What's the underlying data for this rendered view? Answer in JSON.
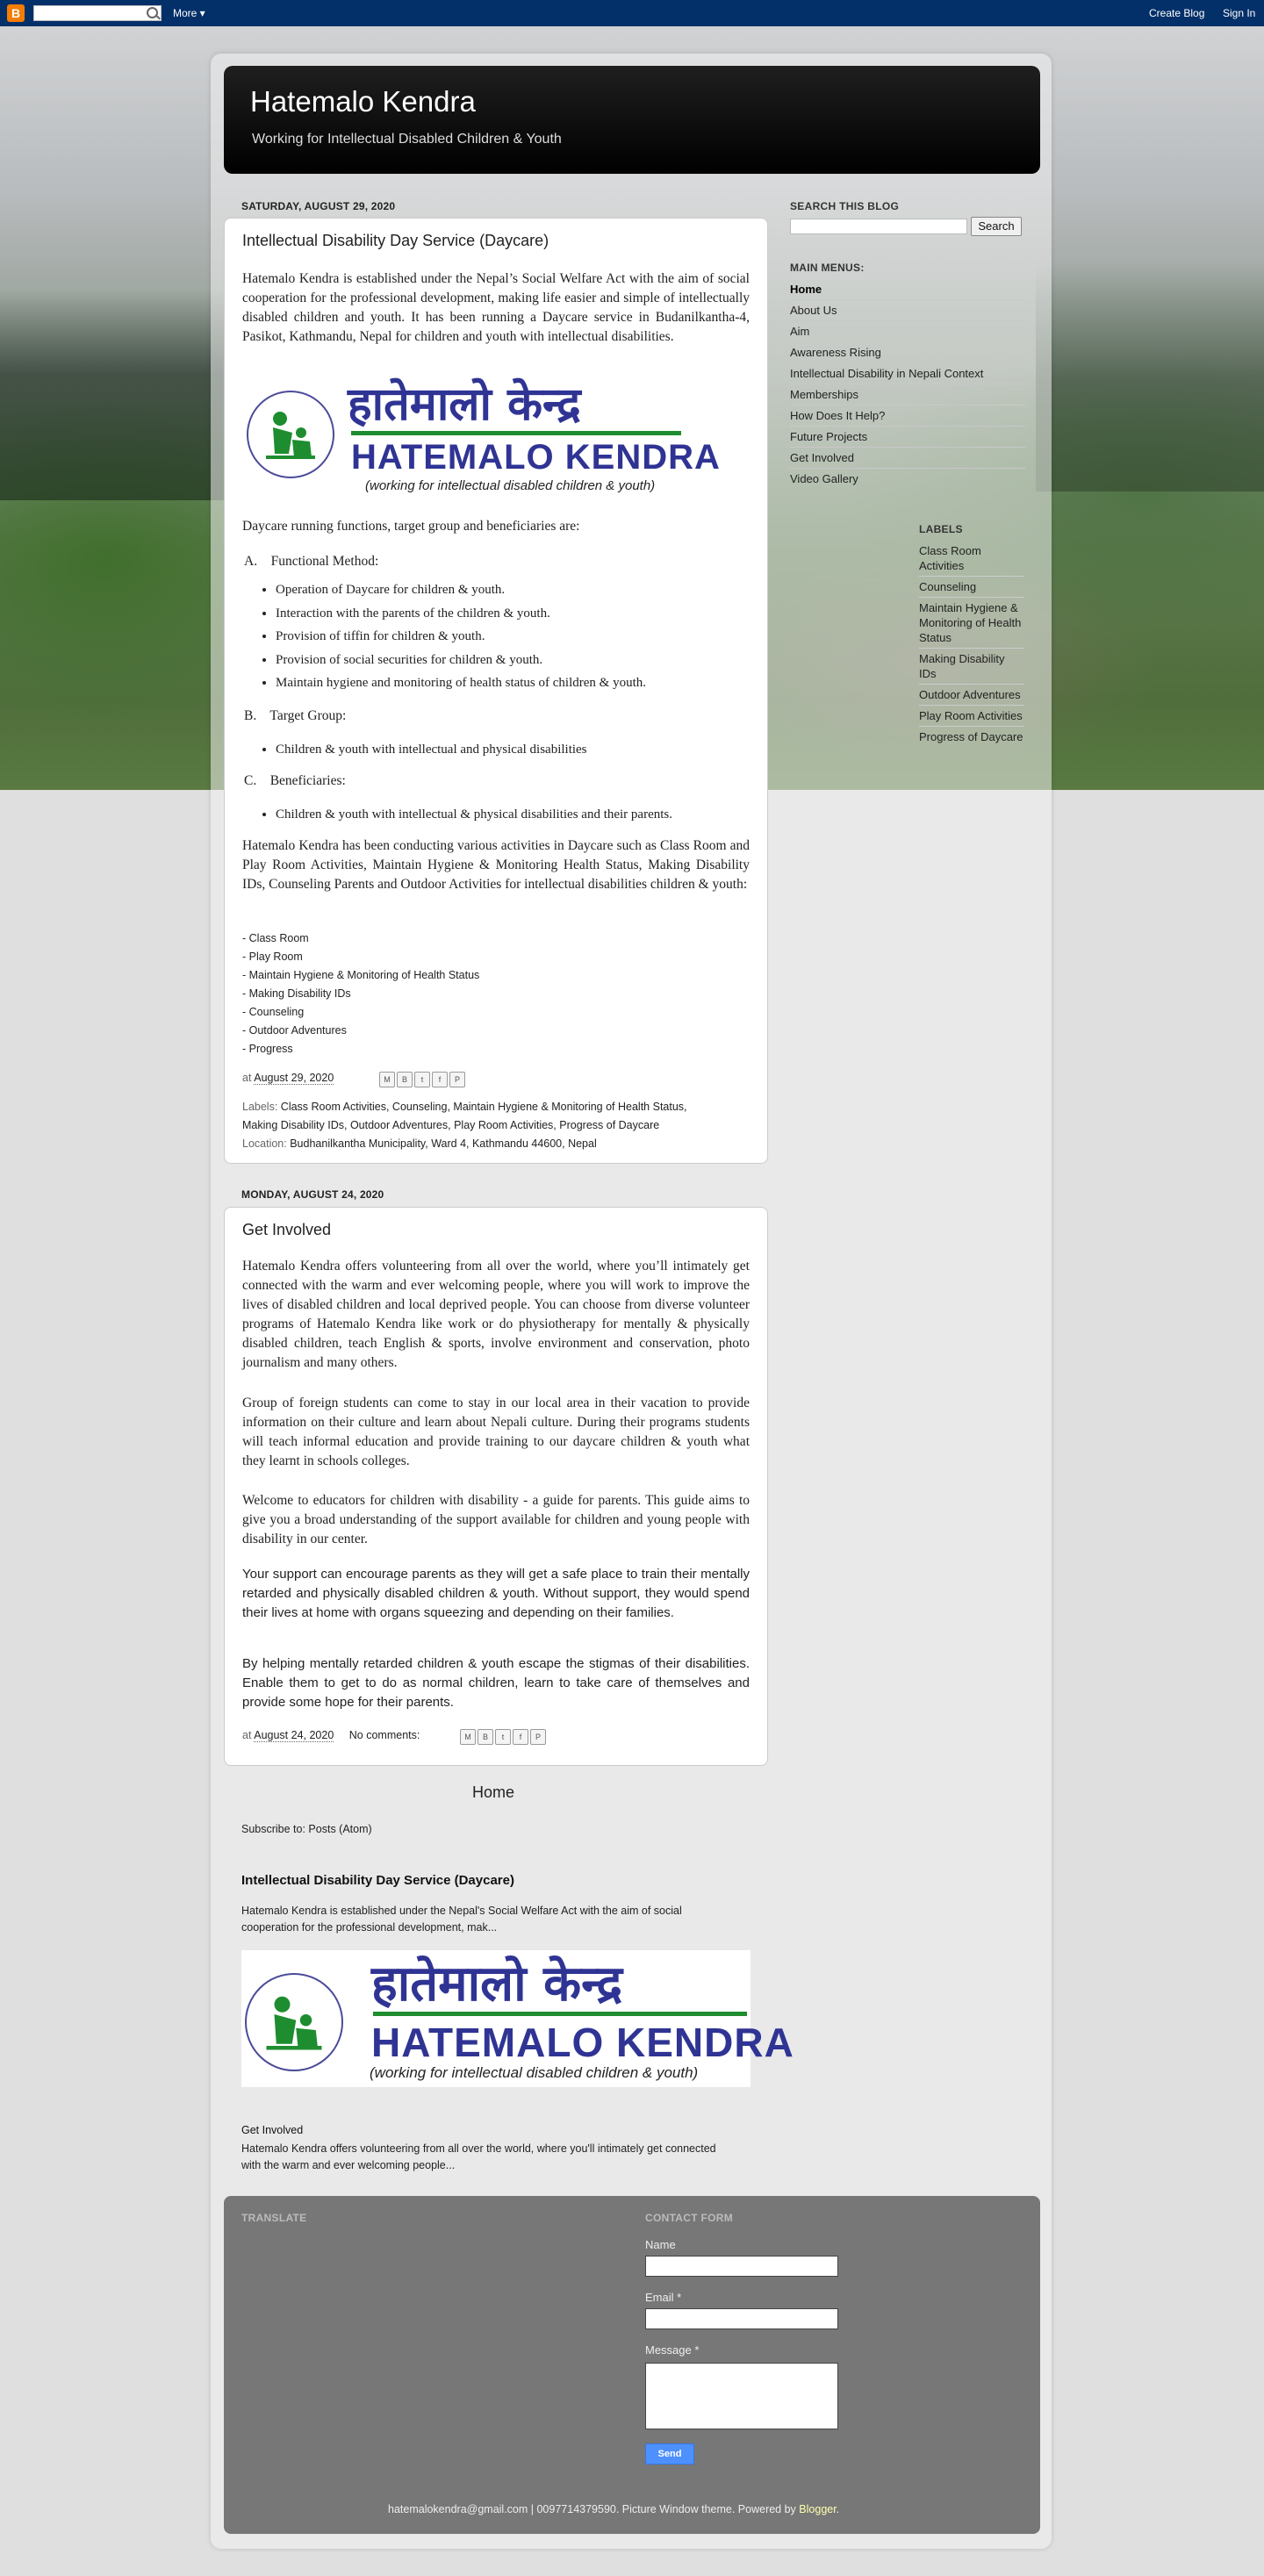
{
  "navbar": {
    "more_label": "More ▾",
    "create_blog": "Create Blog",
    "sign_in": "Sign In"
  },
  "header": {
    "title": "Hatemalo Kendra",
    "description": "Working for Intellectual Disabled Children & Youth"
  },
  "post1": {
    "date": "SATURDAY, AUGUST 29, 2020",
    "title": "Intellectual Disability Day Service (Daycare)",
    "intro": "Hatemalo Kendra is established under the Nepal’s Social Welfare Act with the aim of social cooperation for the professional development, making life easier and simple of intellectually disabled children and youth. It has been running a Daycare service in Budanilkantha-4, Pasikot, Kathmandu, Nepal for children and youth with intellectual disabilities.",
    "logo": {
      "devanagari": "हातेमालो केन्द्र",
      "latin": "HATEMALO KENDRA",
      "tagline": "(working for intellectual disabled children & youth)"
    },
    "functions_intro": "Daycare running functions, target group and beneficiaries are:",
    "section_a": "A.    Functional Method:",
    "section_a_items": [
      "Operation of Daycare for children & youth.",
      "Interaction with the parents of the children & youth.",
      "Provision of tiffin for children & youth.",
      "Provision of social securities for children & youth.",
      "Maintain hygiene and monitoring of health status of children & youth."
    ],
    "section_b": "B.    Target Group:",
    "section_b_items": [
      "Children & youth with intellectual and physical disabilities"
    ],
    "section_c": "C.    Beneficiaries:",
    "section_c_items": [
      "Children & youth with intellectual & physical disabilities and their parents."
    ],
    "activities": "Hatemalo Kendra has been conducting various activities in Daycare such as Class Room and Play Room Activities, Maintain Hygiene & Monitoring Health Status, Making Disability IDs, Counseling Parents and Outdoor Activities for intellectual disabilities children & youth:",
    "activity_list": [
      "- Class Room",
      "- Play Room",
      "- Maintain Hygiene & Monitoring of Health Status",
      "- Making Disability IDs",
      "- Counseling",
      "- Outdoor Adventures",
      "- Progress"
    ],
    "at": "at",
    "timestamp": "August 29, 2020",
    "labels_prefix": "Labels:",
    "labels_line1": "Class Room Activities, Counseling, Maintain Hygiene & Monitoring of Health Status,",
    "labels_line2": "Making Disability IDs, Outdoor Adventures, Play Room Activities, Progress of Daycare",
    "location_prefix": "Location:",
    "location": "Budhanilkantha Municipality, Ward 4, Kathmandu 44600, Nepal"
  },
  "post2": {
    "date": "MONDAY, AUGUST 24, 2020",
    "title": "Get Involved",
    "p1": "Hatemalo Kendra offers volunteering from all over the world, where you’ll intimately get connected with the warm and ever welcoming people, where you will work to improve the lives of disabled children and local deprived people. You can choose from diverse volunteer programs of Hatemalo Kendra like work or do physiotherapy for mentally & physically disabled children, teach English & sports, involve environment and conservation, photo journalism and many others.",
    "p2": "Group of foreign students can come to stay in our local area in their vacation to provide information on their culture and learn about Nepali culture. During their programs students will teach informal education and provide training to our daycare children & youth what they learnt in schools colleges.",
    "p3": "Welcome to educators for children with disability - a guide for parents. This guide aims to give you a broad understanding of the support available for children and young people with disability in our center.",
    "p4": "Your support can encourage parents as they will get a safe place to train their mentally retarded and physically disabled children & youth. Without support, they would spend their lives at home with organs squeezing and depending on their families.",
    "p5": "By helping mentally retarded children & youth escape the stigmas of their disabilities. Enable them to get to do as normal children, learn to take care of themselves and provide some hope for their parents.",
    "at": "at",
    "timestamp": "August 24, 2020",
    "comments": "No comments:"
  },
  "home_link": "Home",
  "subscribe": "Subscribe to: Posts (Atom)",
  "popular": {
    "title": "Intellectual Disability Day Service (Daycare)",
    "snippet": "Hatemalo Kendra is established under the Nepal's Social Welfare Act with the aim of social cooperation for the professional development, mak...",
    "item2_title": "Get Involved",
    "item2_snippet": "Hatemalo Kendra offers volunteering from all over the world, where you'll intimately get connected with the warm and ever welcoming people..."
  },
  "sidebar": {
    "search_heading": "SEARCH THIS BLOG",
    "search_button": "Search",
    "menu_heading": "MAIN MENUS:",
    "menu_items": [
      "Home",
      "About Us",
      "Aim",
      "Awareness Rising",
      "Intellectual Disability in Nepali Context",
      "Memberships",
      "How Does It Help?",
      "Future Projects",
      "Get Involved",
      "Video Gallery"
    ],
    "labels_heading": "LABELS",
    "labels": [
      "Class Room Activities",
      "Counseling",
      "Maintain Hygiene & Monitoring of Health Status",
      "Making Disability IDs",
      "Outdoor Adventures",
      "Play Room Activities",
      "Progress of Daycare"
    ]
  },
  "footer": {
    "translate_heading": "TRANSLATE",
    "contact_heading": "CONTACT FORM",
    "name_label": "Name",
    "email_label": "Email",
    "message_label": "Message",
    "required_mark": "*",
    "send_label": "Send",
    "credit": "hatemalokendra@gmail.com | 0097714379590. Picture Window theme. Powered by",
    "blogger": "Blogger",
    "period": "."
  }
}
